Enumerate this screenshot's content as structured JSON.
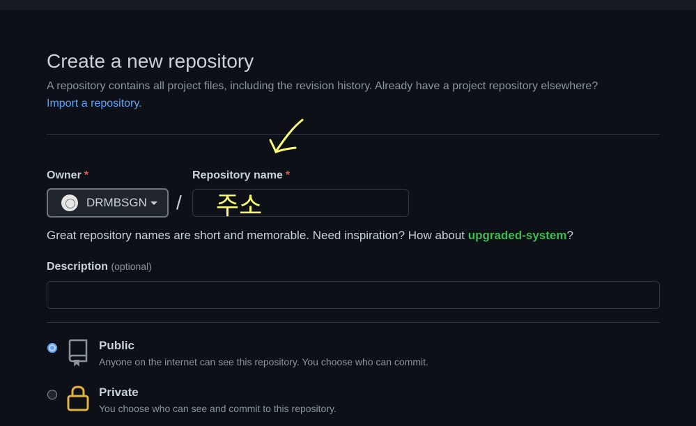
{
  "header": {
    "title": "Create a new repository",
    "subtitle": "A repository contains all project files, including the revision history. Already have a project repository elsewhere?",
    "import_link": "Import a repository."
  },
  "owner": {
    "label": "Owner",
    "required_mark": "*",
    "value": "DRMBSGN"
  },
  "separator": "/",
  "repo_name": {
    "label": "Repository name",
    "required_mark": "*",
    "value": "",
    "annotation_text": "주소"
  },
  "hint": {
    "text": "Great repository names are short and memorable. Need inspiration? How about ",
    "suggestion": "upgraded-system",
    "suffix": "?"
  },
  "description": {
    "label": "Description",
    "optional": "(optional)",
    "value": ""
  },
  "visibility": {
    "public": {
      "title": "Public",
      "desc": "Anyone on the internet can see this repository. You choose who can commit.",
      "icon": "repo-icon",
      "selected": true
    },
    "private": {
      "title": "Private",
      "desc": "You choose who can see and commit to this repository.",
      "icon": "lock-icon",
      "selected": false
    }
  },
  "colors": {
    "background": "#0d1117",
    "link": "#58a6ff",
    "suggestion": "#3fb950",
    "required": "#f85149",
    "annotation": "#ffff6e",
    "lock": "#e3b341"
  }
}
